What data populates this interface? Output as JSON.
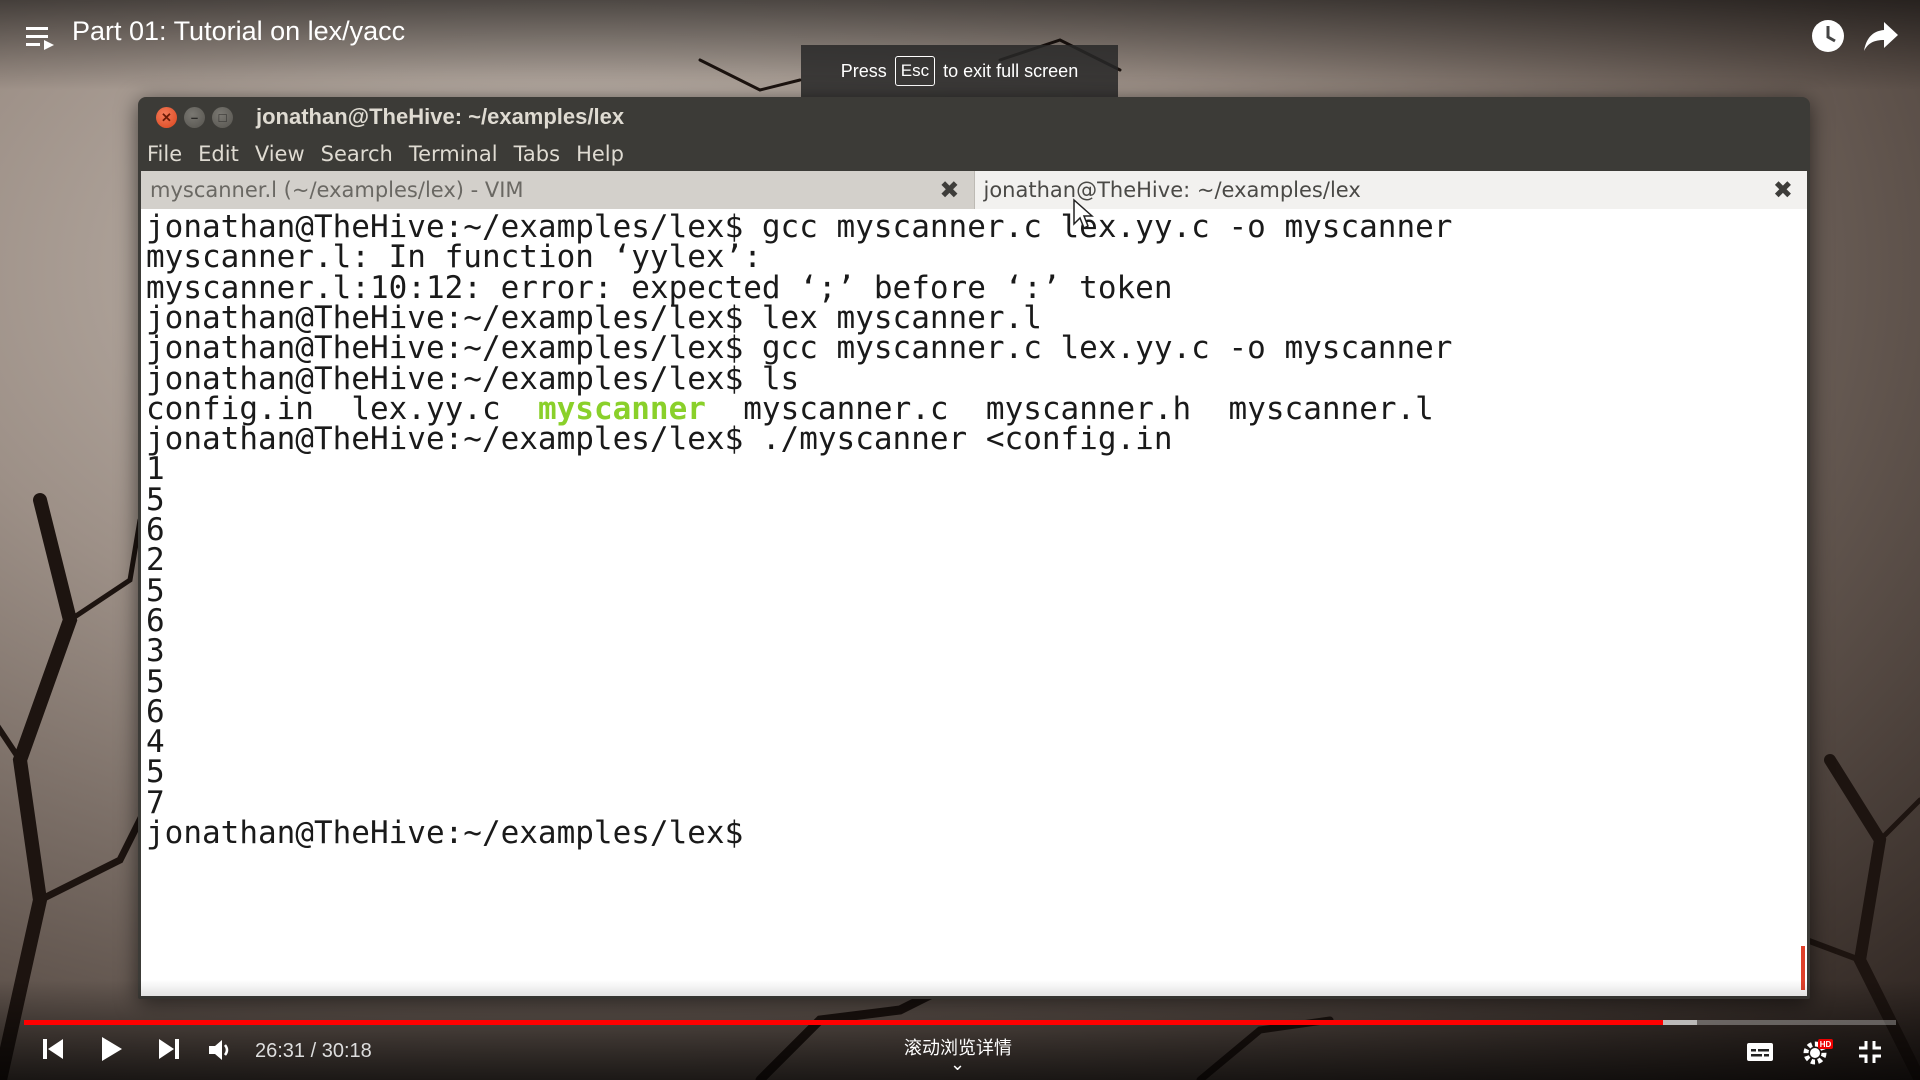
{
  "video": {
    "title": "Part 01: Tutorial on lex/yacc",
    "esc_press": "Press",
    "esc_key": "Esc",
    "esc_suffix": "to exit full screen"
  },
  "window": {
    "title": "jonathan@TheHive: ~/examples/lex",
    "menu": [
      "File",
      "Edit",
      "View",
      "Search",
      "Terminal",
      "Tabs",
      "Help"
    ],
    "tabs": [
      {
        "label": "myscanner.l (~/examples/lex) - VIM",
        "active": false
      },
      {
        "label": "jonathan@TheHive: ~/examples/lex",
        "active": true
      }
    ]
  },
  "terminal": {
    "lines": [
      "jonathan@TheHive:~/examples/lex$ gcc myscanner.c lex.yy.c -o myscanner",
      "myscanner.l: In function ‘yylex’:",
      "myscanner.l:10:12: error: expected ‘;’ before ‘:’ token",
      "jonathan@TheHive:~/examples/lex$ lex myscanner.l",
      "jonathan@TheHive:~/examples/lex$ gcc myscanner.c lex.yy.c -o myscanner",
      "jonathan@TheHive:~/examples/lex$ ls",
      "",
      "jonathan@TheHive:~/examples/lex$ ./myscanner <config.in",
      "1",
      "5",
      "6",
      "2",
      "5",
      "6",
      "3",
      "5",
      "6",
      "4",
      "5",
      "7",
      "jonathan@TheHive:~/examples/lex$"
    ],
    "ls_listing": {
      "a": "config.in",
      "b": "lex.yy.c",
      "c": "myscanner",
      "d": "myscanner.c",
      "e": "myscanner.h",
      "f": "myscanner.l"
    },
    "executable_color": "#8ad02a"
  },
  "player": {
    "time": "26:31 / 30:18",
    "progress_fraction": 0.8753,
    "buffered_fraction": 0.8939,
    "scroll_hint": "滚动浏览详情",
    "progress_color": "#ff0000"
  },
  "icons": {
    "playlist": "playlist-icon",
    "watch_later": "clock-icon",
    "share": "share-icon",
    "prev": "previous-icon",
    "play": "play-icon",
    "next": "next-icon",
    "volume": "volume-icon",
    "subtitles": "subtitles-icon",
    "settings": "gear-icon",
    "exit_fullscreen": "exit-fullscreen-icon"
  }
}
